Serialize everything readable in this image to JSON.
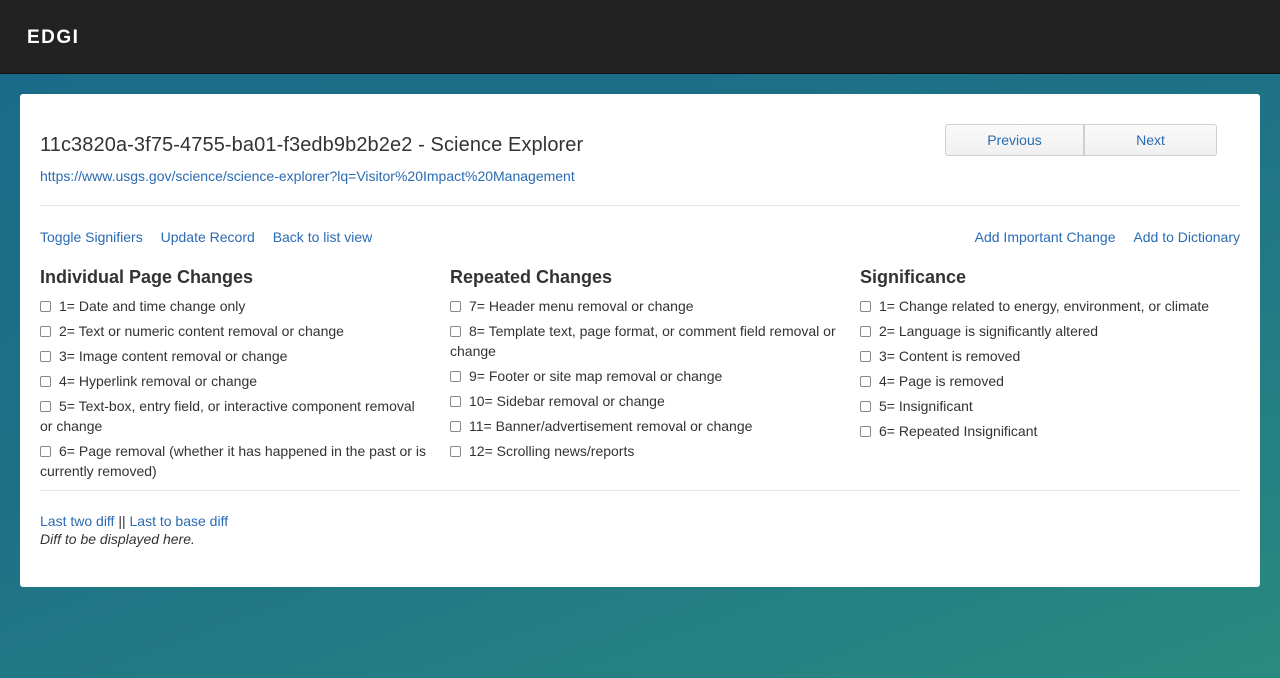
{
  "navbar": {
    "brand": "EDGI"
  },
  "header": {
    "title": "11c3820a-3f75-4755-ba01-f3edb9b2b2e2 - Science Explorer",
    "url": "https://www.usgs.gov/science/science-explorer?lq=Visitor%20Impact%20Management",
    "previous_label": "Previous",
    "next_label": "Next"
  },
  "actions": {
    "left": [
      "Toggle Signifiers",
      "Update Record",
      "Back to list view"
    ],
    "right": [
      "Add Important Change",
      "Add to Dictionary"
    ]
  },
  "columns": [
    {
      "heading": "Individual Page Changes",
      "options": [
        "1= Date and time change only",
        "2= Text or numeric content removal or change",
        "3= Image content removal or change",
        "4= Hyperlink removal or change",
        "5= Text-box, entry field, or interactive component removal or change",
        "6= Page removal (whether it has happened in the past or is currently removed)"
      ]
    },
    {
      "heading": "Repeated Changes",
      "options": [
        "7= Header menu removal or change",
        "8= Template text, page format, or comment field removal or change",
        "9= Footer or site map removal or change",
        "10= Sidebar removal or change",
        "11= Banner/advertisement removal or change",
        "12= Scrolling news/reports"
      ]
    },
    {
      "heading": "Significance",
      "options": [
        "1= Change related to energy, environment, or climate",
        "2= Language is significantly altered",
        "3= Content is removed",
        "4= Page is removed",
        "5= Insignificant",
        "6= Repeated Insignificant"
      ]
    }
  ],
  "diff": {
    "last_two_label": "Last two diff",
    "separator": "||",
    "last_to_base_label": "Last to base diff",
    "note": "Diff to be displayed here."
  },
  "colors": {
    "navbar_bg": "#222222",
    "link": "#2a6bb3",
    "background_gradient_start": "#1a6a8a",
    "background_gradient_end": "#2a8a80"
  }
}
